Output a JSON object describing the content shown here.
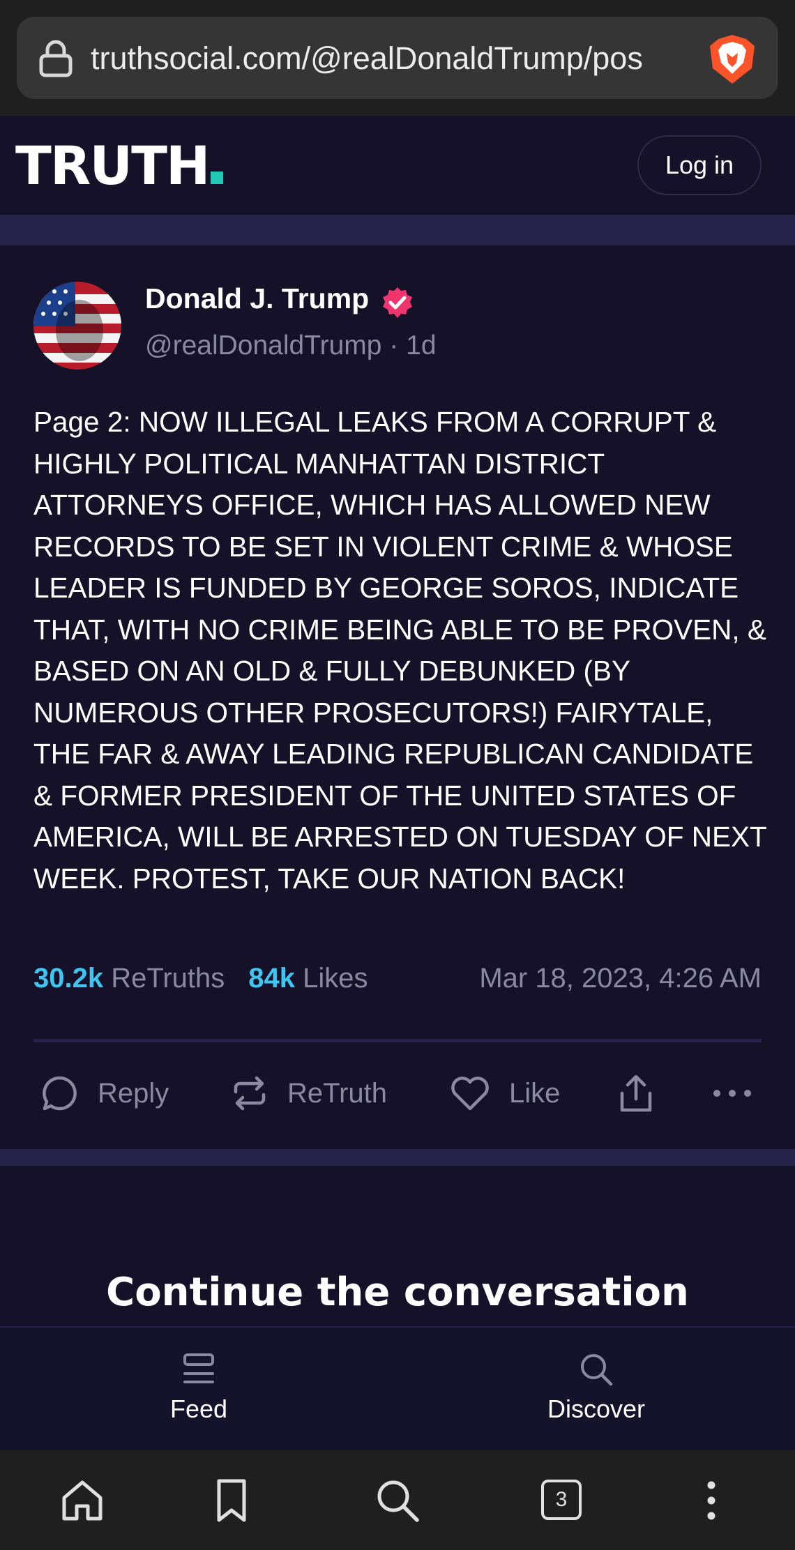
{
  "browser": {
    "url": "truthsocial.com/@realDonaldTrump/pos",
    "tab_count": "3"
  },
  "header": {
    "logo": "TRUTH",
    "login_label": "Log in"
  },
  "post": {
    "author_name": "Donald J. Trump",
    "author_handle": "@realDonaldTrump",
    "separator": "·",
    "age": "1d",
    "body": "Page 2: NOW ILLEGAL LEAKS FROM A CORRUPT & HIGHLY POLITICAL MANHATTAN DISTRICT ATTORNEYS OFFICE, WHICH HAS ALLOWED NEW RECORDS TO BE SET IN VIOLENT CRIME & WHOSE LEADER IS FUNDED BY GEORGE SOROS, INDICATE THAT, WITH NO CRIME BEING ABLE TO BE PROVEN, & BASED ON AN OLD & FULLY DEBUNKED (BY NUMEROUS OTHER PROSECUTORS!) FAIRYTALE, THE FAR & AWAY LEADING REPUBLICAN CANDIDATE & FORMER PRESIDENT OF THE UNITED STATES OF AMERICA, WILL BE ARRESTED ON TUESDAY OF NEXT WEEK. PROTEST, TAKE OUR NATION BACK!",
    "retruths_count": "30.2k",
    "retruths_label": "ReTruths",
    "likes_count": "84k",
    "likes_label": "Likes",
    "timestamp": "Mar 18, 2023, 4:26 AM",
    "actions": {
      "reply": "Reply",
      "retruth": "ReTruth",
      "like": "Like"
    }
  },
  "continue_title": "Continue the conversation",
  "app_nav": {
    "feed": "Feed",
    "discover": "Discover"
  },
  "colors": {
    "background": "#141129",
    "accent": "#3ec6f0",
    "logo_dot": "#22c9b6",
    "verified": "#f0356e"
  },
  "icons": [
    "lock-icon",
    "brave-lion-icon",
    "verified-badge-icon",
    "reply-icon",
    "retruth-icon",
    "heart-icon",
    "share-icon",
    "more-icon",
    "feed-icon",
    "discover-icon",
    "home-icon",
    "bookmark-icon",
    "search-icon",
    "tabs-icon",
    "menu-icon"
  ]
}
